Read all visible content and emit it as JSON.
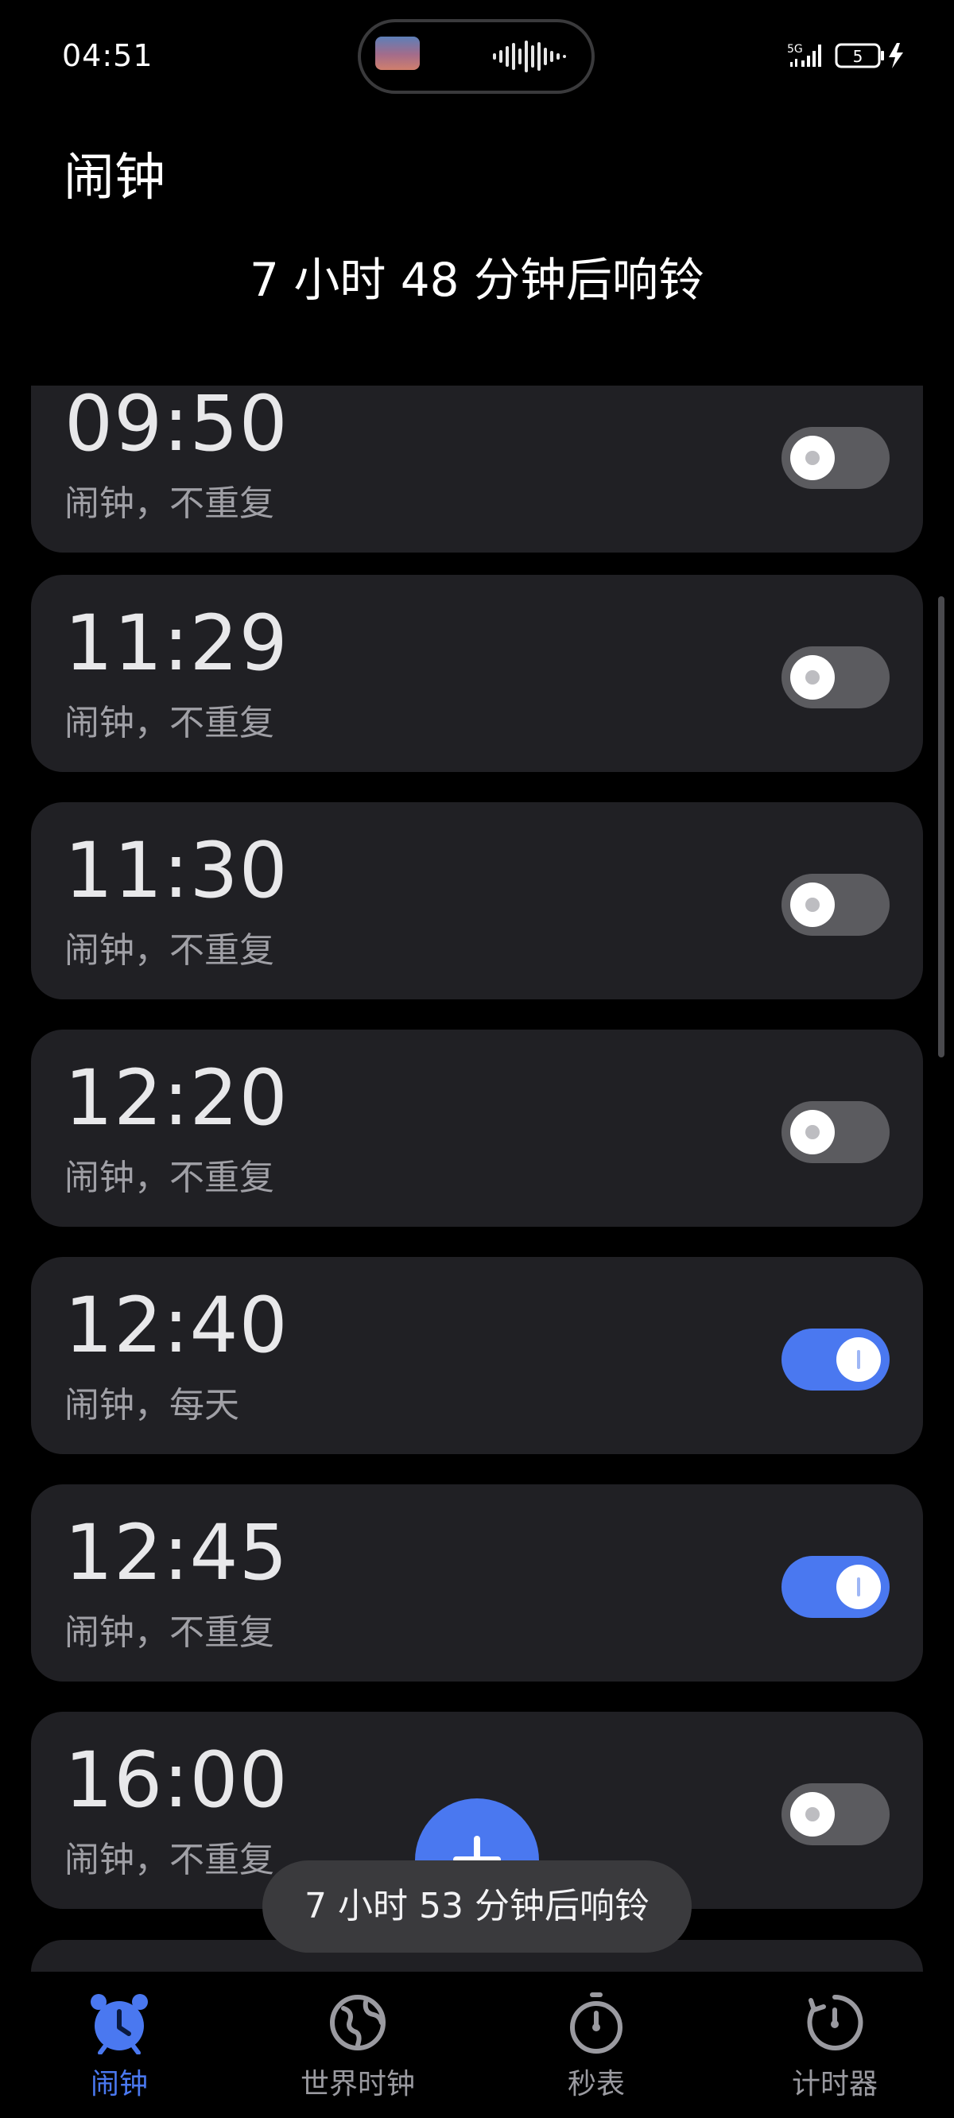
{
  "status_bar": {
    "time": "04:51",
    "network": "5G",
    "battery": "5",
    "charging_icon": "bolt-icon"
  },
  "header": {
    "title": "闹钟",
    "next_ring": "7 小时 48 分钟后响铃"
  },
  "alarms": [
    {
      "time": "09:50",
      "label": "闹钟，不重复",
      "enabled": false
    },
    {
      "time": "11:29",
      "label": "闹钟，不重复",
      "enabled": false
    },
    {
      "time": "11:30",
      "label": "闹钟，不重复",
      "enabled": false
    },
    {
      "time": "12:20",
      "label": "闹钟，不重复",
      "enabled": false
    },
    {
      "time": "12:40",
      "label": "闹钟，每天",
      "enabled": true
    },
    {
      "time": "12:45",
      "label": "闹钟，不重复",
      "enabled": true
    },
    {
      "time": "16:00",
      "label": "闹钟，不重复",
      "enabled": false
    }
  ],
  "toast": "7 小时 53 分钟后响铃",
  "fab": {
    "icon": "plus-icon"
  },
  "bottom_nav": [
    {
      "label": "闹钟",
      "icon": "alarm-clock-icon",
      "active": true
    },
    {
      "label": "世界时钟",
      "icon": "globe-icon",
      "active": false
    },
    {
      "label": "秒表",
      "icon": "stopwatch-icon",
      "active": false
    },
    {
      "label": "计时器",
      "icon": "timer-icon",
      "active": false
    }
  ],
  "colors": {
    "accent": "#4a78f0",
    "card": "#202024",
    "background": "#000000"
  }
}
